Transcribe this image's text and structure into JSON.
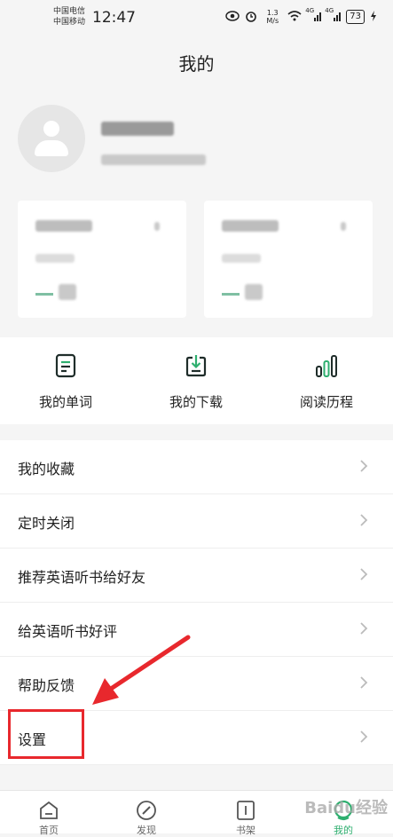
{
  "status_bar": {
    "carrier_1": "中国电信",
    "carrier_2": "中国移动",
    "time": "12:47",
    "network_speed": "1.3 M/s",
    "signal_1": "4G",
    "signal_2": "4G",
    "battery": "73"
  },
  "header": {
    "title": "我的"
  },
  "quick_actions": [
    {
      "label": "我的单词",
      "icon": "word-book-icon"
    },
    {
      "label": "我的下载",
      "icon": "download-icon"
    },
    {
      "label": "阅读历程",
      "icon": "bar-chart-icon"
    }
  ],
  "menu": [
    {
      "label": "我的收藏"
    },
    {
      "label": "定时关闭"
    },
    {
      "label": "推荐英语听书给好友"
    },
    {
      "label": "给英语听书好评"
    },
    {
      "label": "帮助反馈"
    },
    {
      "label": "设置"
    }
  ],
  "tabs": [
    {
      "label": "首页",
      "icon": "home-icon"
    },
    {
      "label": "发现",
      "icon": "compass-icon"
    },
    {
      "label": "书架",
      "icon": "bookshelf-icon"
    },
    {
      "label": "我的",
      "icon": "profile-icon",
      "active": true
    }
  ],
  "colors": {
    "accent": "#2eaf6f",
    "annotation": "#e8282d"
  },
  "watermark": "Baidu经验"
}
